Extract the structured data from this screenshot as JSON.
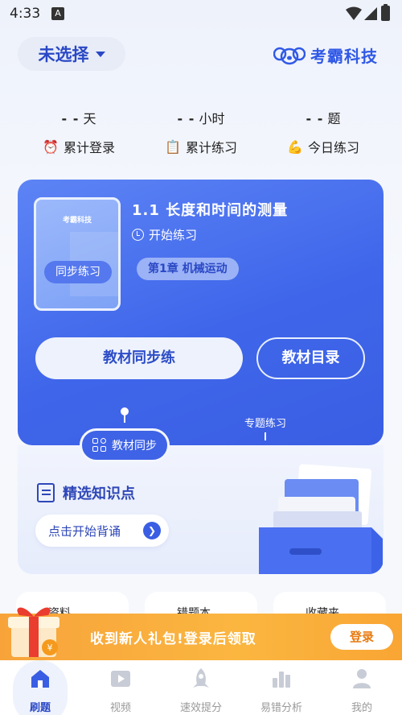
{
  "status_bar": {
    "time": "4:33",
    "notification_letter": "A"
  },
  "header": {
    "selector_label": "未选择",
    "brand": "考霸科技"
  },
  "stats": [
    {
      "value": "- -",
      "unit": "天",
      "icon": "⏰",
      "label": "累计登录"
    },
    {
      "value": "- -",
      "unit": "小时",
      "icon": "📋",
      "label": "累计练习"
    },
    {
      "value": "- -",
      "unit": "题",
      "icon": "💪",
      "label": "今日练习"
    }
  ],
  "lesson": {
    "book_brand": "考霸科技",
    "book_label": "同步练习",
    "title": "1.1  长度和时间的测量",
    "start": "开始练习",
    "chapter": "第1章  机械运动",
    "sync_button": "教材同步练",
    "toc_button": "教材目录"
  },
  "mode_tabs": {
    "sync": "教材同步",
    "special": "专题练习"
  },
  "knowledge": {
    "title": "精选知识点",
    "button": "点击开始背诵"
  },
  "shortcuts": [
    "资料",
    "错题本",
    "收藏夹"
  ],
  "promo": {
    "text": "收到新人礼包!登录后领取",
    "login": "登录"
  },
  "tabbar": [
    {
      "label": "刷题",
      "icon": "home-icon",
      "active": true
    },
    {
      "label": "视频",
      "icon": "video-icon",
      "active": false
    },
    {
      "label": "速效提分",
      "icon": "rocket-icon",
      "active": false
    },
    {
      "label": "易错分析",
      "icon": "bar-chart-icon",
      "active": false
    },
    {
      "label": "我的",
      "icon": "user-icon",
      "active": false
    }
  ],
  "colors": {
    "primary": "#3f66ea",
    "accent": "#2a48c5",
    "promo": "#fbb640"
  }
}
